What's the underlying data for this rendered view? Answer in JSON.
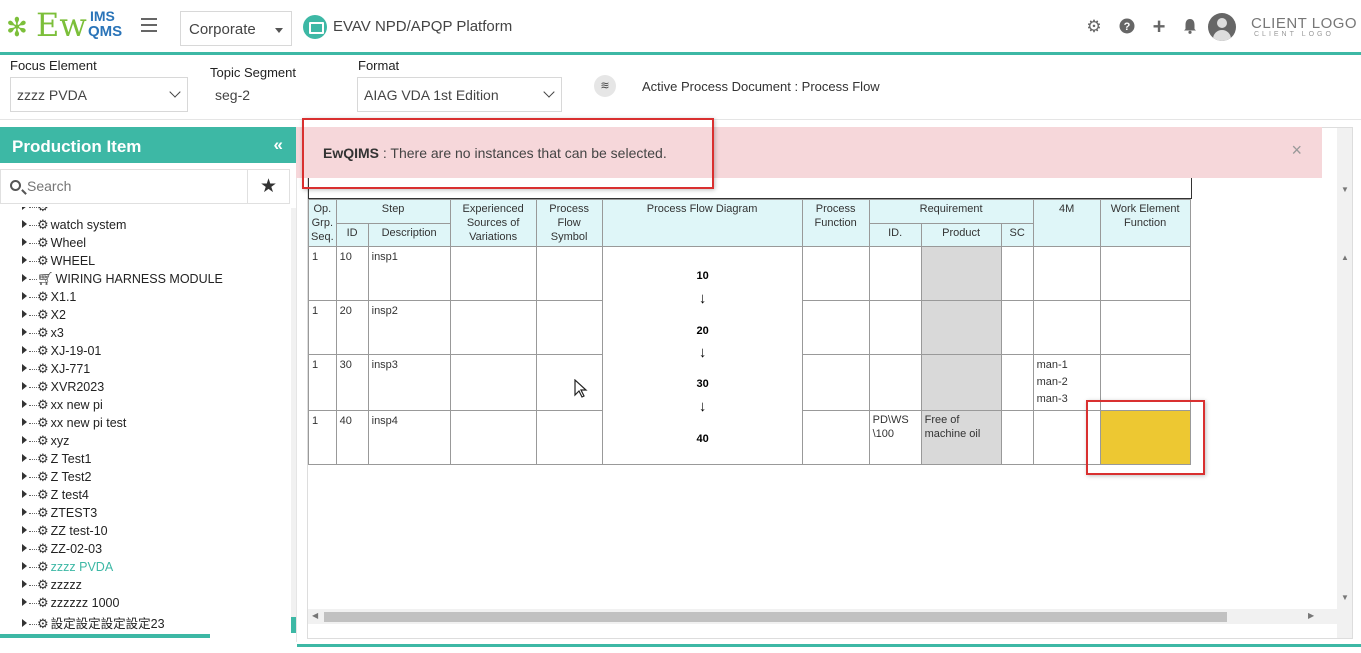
{
  "header": {
    "logo": {
      "main": "Ew",
      "ims": "IMS",
      "qms": "QMS"
    },
    "corporate_select": "Corporate",
    "platform_title": "EVAV NPD/APQP Platform",
    "client_logo": "CLIENT LOGO",
    "client_logo_sub": "CLIENT LOGO",
    "icons": [
      "gear-icon",
      "help-icon",
      "plus-icon",
      "bell-icon",
      "user-avatar"
    ]
  },
  "toolbar": {
    "focus_label": "Focus Element",
    "focus_value": "zzzz PVDA",
    "topic_label": "Topic Segment",
    "topic_value": "seg-2",
    "format_label": "Format",
    "format_value": "AIAG VDA 1st Edition",
    "active_doc": "Active Process Document : Process Flow"
  },
  "sidebar": {
    "title": "Production Item",
    "search_placeholder": "Search",
    "items": [
      {
        "label": "watch system",
        "icon": "gears-icon"
      },
      {
        "label": "Wheel",
        "icon": "gears-icon"
      },
      {
        "label": "WHEEL",
        "icon": "gears-icon"
      },
      {
        "label": "WIRING HARNESS MODULE",
        "icon": "cart-icon"
      },
      {
        "label": "X1.1",
        "icon": "gears-icon"
      },
      {
        "label": "X2",
        "icon": "gears-icon"
      },
      {
        "label": "x3",
        "icon": "gears-icon"
      },
      {
        "label": "XJ-19-01",
        "icon": "gears-icon"
      },
      {
        "label": "XJ-771",
        "icon": "gears-icon"
      },
      {
        "label": "XVR2023",
        "icon": "gears-icon"
      },
      {
        "label": "xx new pi",
        "icon": "gears-icon"
      },
      {
        "label": "xx new pi test",
        "icon": "gears-icon"
      },
      {
        "label": "xyz",
        "icon": "gears-icon"
      },
      {
        "label": "Z Test1",
        "icon": "gears-icon"
      },
      {
        "label": "Z Test2",
        "icon": "gears-icon"
      },
      {
        "label": "Z test4",
        "icon": "gears-icon"
      },
      {
        "label": "ZTEST3",
        "icon": "gears-icon"
      },
      {
        "label": "ZZ test-10",
        "icon": "gears-icon"
      },
      {
        "label": "ZZ-02-03",
        "icon": "gears-icon"
      },
      {
        "label": "zzzz PVDA",
        "icon": "gears-icon",
        "active": true
      },
      {
        "label": "zzzzz",
        "icon": "gears-icon"
      },
      {
        "label": "zzzzzz 1000",
        "icon": "gears-icon"
      },
      {
        "label": "設定設定設定設定23",
        "icon": "gears-icon"
      }
    ]
  },
  "alert": {
    "source": "EwQIMS",
    "message": " : There are no instances that can be selected.",
    "close": "×"
  },
  "table": {
    "headers": {
      "op": "Op. Grp. Seq.",
      "step": "Step",
      "id": "ID",
      "description": "Description",
      "sources": "Experienced Sources of Variations",
      "symbol": "Process Flow Symbol",
      "diagram": "Process Flow Diagram",
      "function": "Process Function",
      "requirement": "Requirement",
      "req_id": "ID.",
      "product": "Product",
      "sc": "SC",
      "m4": "4M",
      "work_element": "Work Element Function"
    },
    "rows": [
      {
        "op": "1",
        "id": "10",
        "desc": "insp1",
        "req_id": "",
        "product": "",
        "m4": ""
      },
      {
        "op": "1",
        "id": "20",
        "desc": "insp2",
        "req_id": "",
        "product": "",
        "m4": ""
      },
      {
        "op": "1",
        "id": "30",
        "desc": "insp3",
        "req_id": "",
        "product": "",
        "m4": "man-1\nman-2\nman-3"
      },
      {
        "op": "1",
        "id": "40",
        "desc": "insp4",
        "req_id": "PD\\WS\\100",
        "product": "Free of machine oil",
        "m4": ""
      }
    ],
    "flow_nodes": [
      "10",
      "20",
      "30",
      "40"
    ],
    "flow_arrow": "↓"
  },
  "colors": {
    "accent": "#3db8a5",
    "alert_bg": "#f6d7da",
    "highlight_red": "#d93030",
    "work_element_fill": "#edc832",
    "header_cell_bg": "#dff6f8"
  }
}
